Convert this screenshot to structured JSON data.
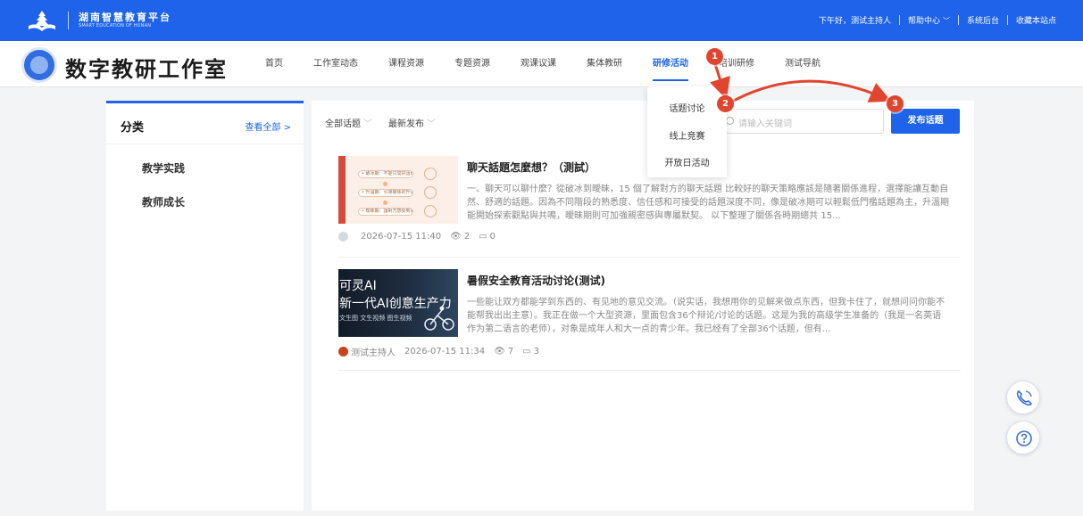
{
  "topbar": {
    "platform_cn": "湖南智慧教育平台",
    "platform_en": "SMART EDUCATION OF HUNAN",
    "greeting": "下午好，测试主持人",
    "help_center": "帮助中心",
    "admin": "系统后台",
    "bookmark": "收藏本站点"
  },
  "header": {
    "brand": "数字教研工作室",
    "nav": [
      "首页",
      "工作室动态",
      "课程资源",
      "专题资源",
      "观课议课",
      "集体教研",
      "研修活动",
      "培训研修",
      "测试导航"
    ],
    "active_index": 6
  },
  "dropdown": {
    "items": [
      "话题讨论",
      "线上竞赛",
      "开放日活动"
    ]
  },
  "sidebar": {
    "title": "分类",
    "view_all": "查看全部 >",
    "categories": [
      "教学实践",
      "教师成长"
    ]
  },
  "toolbar": {
    "filter_topics": "全部话题",
    "filter_sort": "最新发布",
    "search_placeholder": "请输入关键词",
    "publish_label": "发布话题"
  },
  "posts": [
    {
      "title": "聊天話題怎麼想？（測試）",
      "desc": "一、聊天可以聊什麼？從破冰到曖昧，15 個了解對方的聊天話題 比較好的聊天策略應該是隨著關係進程，選擇能讓互動自然、舒適的話題。因為不同階段的熟悉度、信任感和可接受的話題深度不同，像是破冰期可以輕鬆低門檻話題為主，升溫期能開始探索觀點與共鳴，曖昧期則可加強親密感與專屬默契。 以下整理了關係各時期總共 15...",
      "author": "",
      "datetime": "2026-07-15 11:40",
      "views": "2",
      "comments": "0",
      "thumb_pills": [
        "• 破冰期：不能只問好話題",
        "• 升溫期：引導關係的升溫",
        "• 曖昧期：讓對方感受到真誠"
      ]
    },
    {
      "title": "暑假安全教育活动讨论(测试)",
      "desc": "一些能让双方都能学到东西的、有见地的意见交流。（说实话，我想用你的见解来做点东西，但我卡住了，就想问问你能不能帮我出出主意）。我正在做一个大型资源，里面包含36个辩论/讨论的话题。这是为我的高级学生准备的（我是一名英语作为第二语言的老师），对象是成年人和大一点的青少年。我已经有了全部36个话题，但有...",
      "author": "测试主持人",
      "datetime": "2026-07-15 11:34",
      "views": "7",
      "comments": "3",
      "thumb_line1": "可灵AI",
      "thumb_line2": "新一代AI创意生产力",
      "thumb_line3": "文生图 文生视频 图生视频"
    }
  ],
  "annotations": [
    "1",
    "2",
    "3"
  ],
  "colors": {
    "primary": "#1e63e9",
    "annotation": "#e0452f"
  }
}
